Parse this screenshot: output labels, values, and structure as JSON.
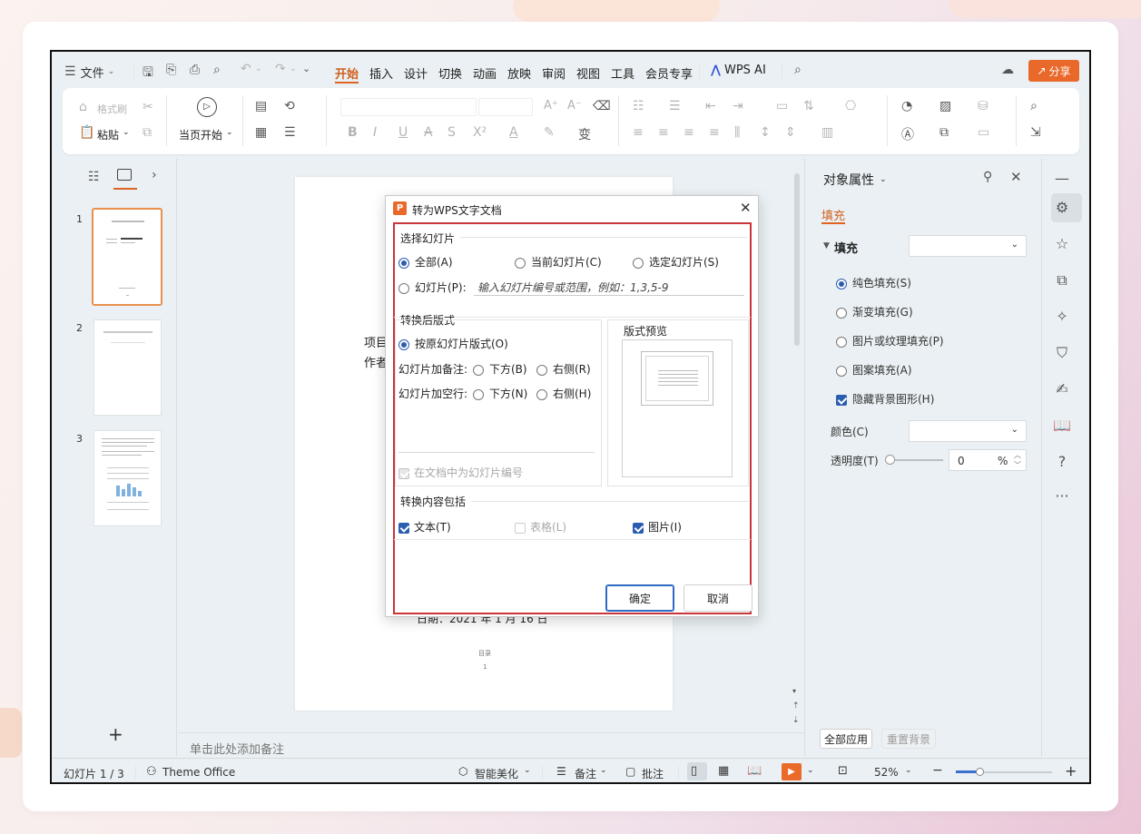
{
  "menu": {
    "file_label": "文件",
    "tabs": [
      "开始",
      "插入",
      "设计",
      "切换",
      "动画",
      "放映",
      "审阅",
      "视图",
      "工具",
      "会员专享"
    ],
    "wps_ai_label": "WPS AI",
    "share_label": "分享"
  },
  "ribbon": {
    "format_painter": "格式刷",
    "paste": "粘贴",
    "start_from_current": "当页开始"
  },
  "thumbs": {
    "numbers": [
      "1",
      "2",
      "3"
    ]
  },
  "slide_text": {
    "line1": "项目",
    "line2": "作者",
    "date_line": "日期：2021 年 1 月 16 日",
    "toc": "目录",
    "page_no": "1"
  },
  "notes_placeholder": "单击此处添加备注",
  "dialog": {
    "title": "转为WPS文字文档",
    "section_select": "选择幻灯片",
    "opt_all": "全部(A)",
    "opt_current": "当前幻灯片(C)",
    "opt_selected": "选定幻灯片(S)",
    "opt_slides": "幻灯片(P):",
    "slides_placeholder": "输入幻灯片编号或范围，例如：1,3,5-9",
    "section_layout": "转换后版式",
    "opt_original_layout": "按原幻灯片版式(O)",
    "notes_label": "幻灯片加备注:",
    "notes_below": "下方(B)",
    "notes_right": "右侧(R)",
    "blank_label": "幻灯片加空行:",
    "blank_below": "下方(N)",
    "blank_right": "右侧(H)",
    "number_slides": "在文档中为幻灯片编号",
    "preview_label": "版式预览",
    "section_content": "转换内容包括",
    "chk_text": "文本(T)",
    "chk_table": "表格(L)",
    "chk_image": "图片(I)",
    "ok": "确定",
    "cancel": "取消"
  },
  "panel": {
    "title": "对象属性",
    "tab_fill": "填充",
    "fill_header": "填充",
    "solid": "纯色填充(S)",
    "gradient": "渐变填充(G)",
    "picture": "图片或纹理填充(P)",
    "pattern": "图案填充(A)",
    "hide_bg": "隐藏背景图形(H)",
    "color_label": "颜色(C)",
    "transparency_label": "透明度(T)",
    "transparency_value": "0",
    "percent": "%",
    "apply_all": "全部应用",
    "reset_bg": "重置背景"
  },
  "statusbar": {
    "slide_info": "幻灯片 1 / 3",
    "theme": "Theme Office",
    "beautify": "智能美化",
    "notes": "备注",
    "comments": "批注",
    "zoom": "52%"
  },
  "colors": {
    "accent": "#e0641f",
    "selection_red": "#c8353a",
    "radio_blue": "#2a5db0"
  }
}
